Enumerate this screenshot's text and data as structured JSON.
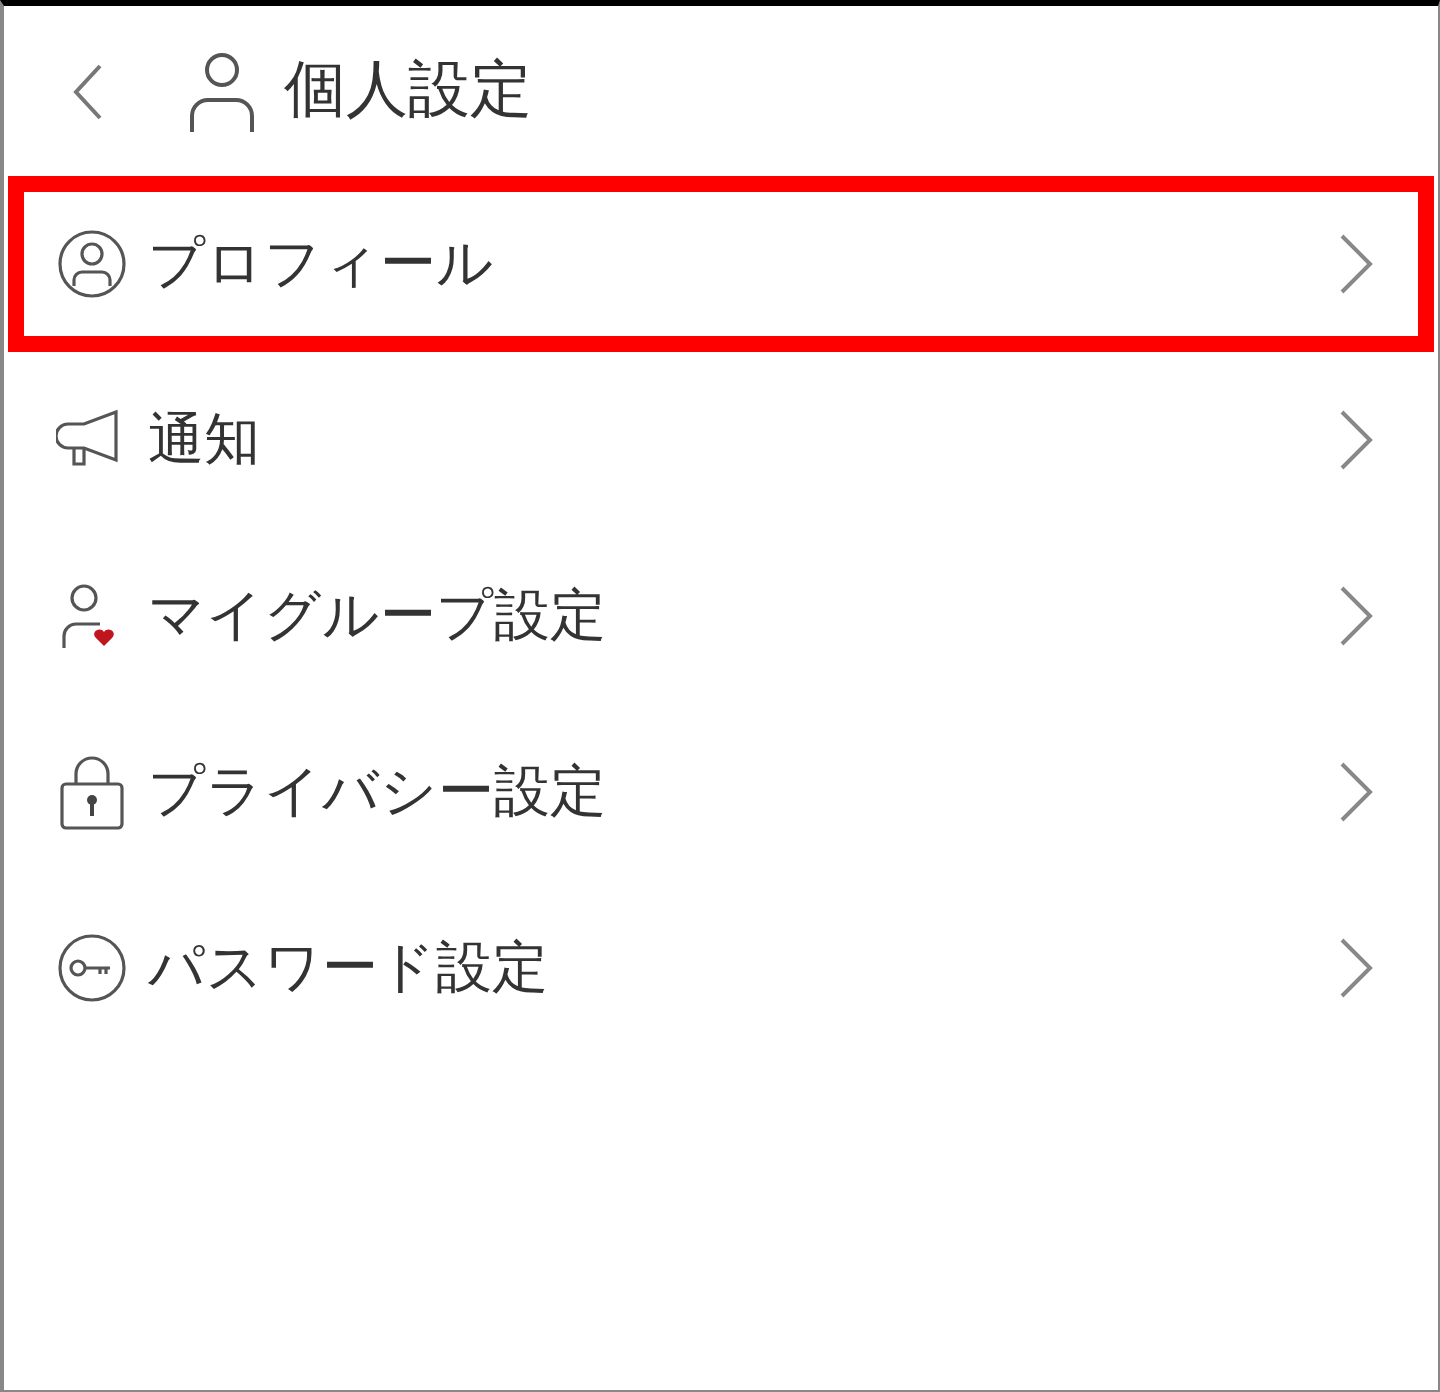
{
  "header": {
    "title": "個人設定"
  },
  "items": [
    {
      "kind": "profile",
      "label": "プロフィール",
      "selected": true
    },
    {
      "kind": "notification",
      "label": "通知",
      "selected": false
    },
    {
      "kind": "group",
      "label": "マイグループ設定",
      "selected": false
    },
    {
      "kind": "privacy",
      "label": "プライバシー設定",
      "selected": false
    },
    {
      "kind": "password",
      "label": "パスワード設定",
      "selected": false
    }
  ]
}
